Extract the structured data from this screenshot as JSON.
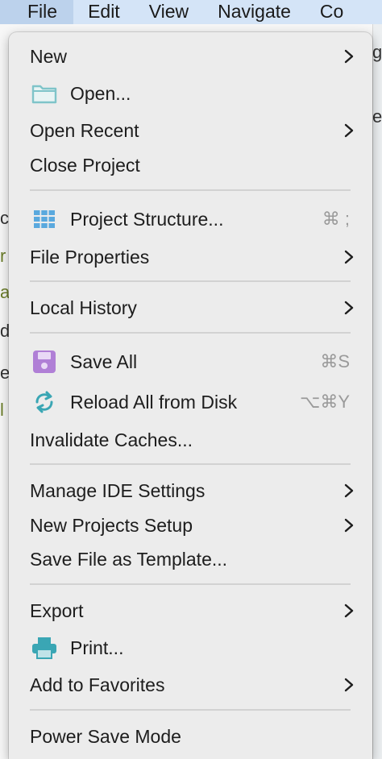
{
  "menubar": {
    "items": [
      "File",
      "Edit",
      "View",
      "Navigate",
      "Co"
    ]
  },
  "background": {
    "fragments": [
      "g",
      "e",
      "c",
      "r",
      "a",
      "d",
      "e",
      "l"
    ]
  },
  "menu": {
    "items": [
      {
        "label": "New",
        "submenu": true
      },
      {
        "label": "Open...",
        "icon": "folder-icon"
      },
      {
        "label": "Open Recent",
        "submenu": true
      },
      {
        "label": "Close Project"
      },
      {
        "label": "Project Structure...",
        "icon": "project-structure-icon",
        "shortcut": "⌘ ;"
      },
      {
        "label": "File Properties",
        "submenu": true
      },
      {
        "label": "Local History",
        "submenu": true
      },
      {
        "label": "Save All",
        "icon": "save-icon",
        "shortcut": "⌘S"
      },
      {
        "label": "Reload All from Disk",
        "icon": "reload-icon",
        "shortcut": "⌥⌘Y"
      },
      {
        "label": "Invalidate Caches..."
      },
      {
        "label": "Manage IDE Settings",
        "submenu": true
      },
      {
        "label": "New Projects Setup",
        "submenu": true
      },
      {
        "label": "Save File as Template..."
      },
      {
        "label": "Export",
        "submenu": true
      },
      {
        "label": "Print...",
        "icon": "print-icon"
      },
      {
        "label": "Add to Favorites",
        "submenu": true
      },
      {
        "label": "Power Save Mode"
      }
    ]
  },
  "colors": {
    "menubar_bg": "#d4e4f7",
    "menu_bg": "#ececec",
    "folder_icon": "#7fc4c9",
    "structure_icon": "#5aa9de",
    "save_icon": "#b07fd6",
    "reload_icon": "#3aa6b4",
    "print_icon": "#3aa6b4"
  }
}
